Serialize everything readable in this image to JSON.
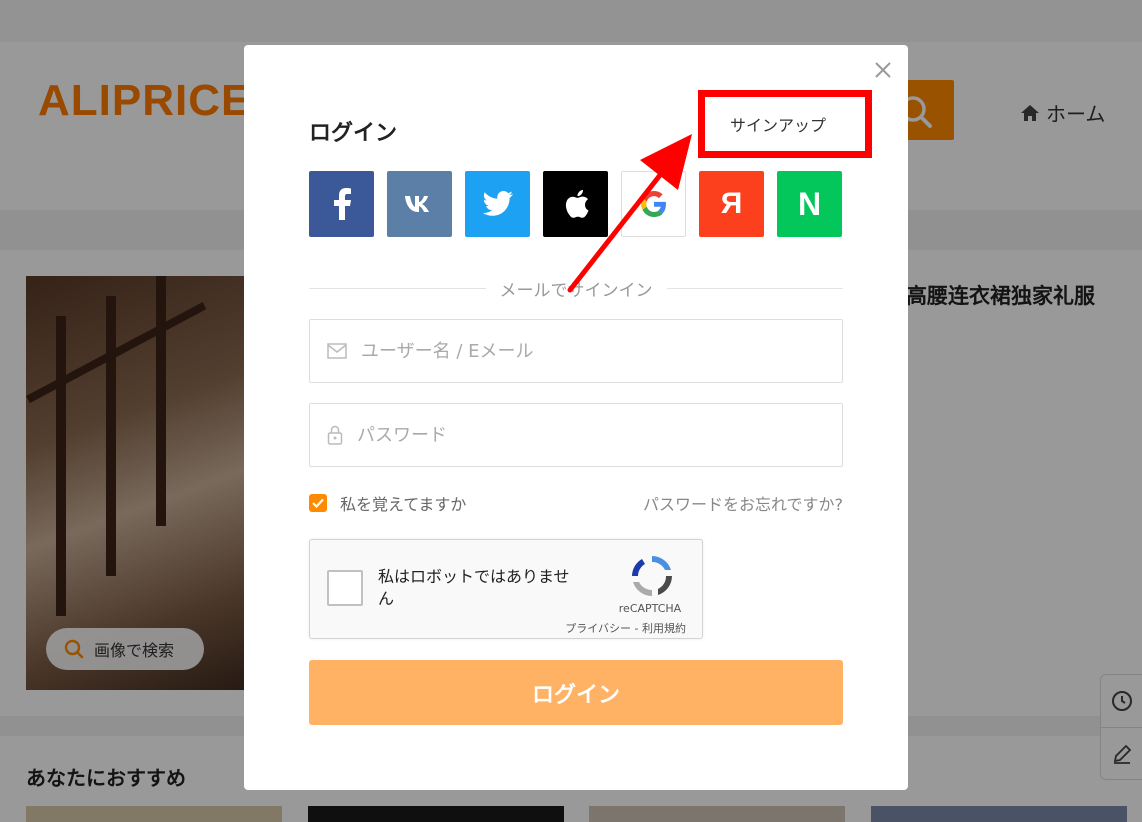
{
  "background": {
    "logo": "ALIPRICE",
    "home_label": "ホーム",
    "product_title": "高腰连衣裙独家礼服",
    "image_search_label": "画像で検索",
    "recommend_title": "あなたにおすすめ"
  },
  "modal": {
    "title": "ログイン",
    "signup_label": "サインアップ",
    "social": [
      {
        "name": "facebook",
        "glyph": "f",
        "color": "#3b5998"
      },
      {
        "name": "vk",
        "glyph": "vk",
        "color": "#5b7fa6"
      },
      {
        "name": "twitter",
        "glyph": "twitter",
        "color": "#1da1f2"
      },
      {
        "name": "apple",
        "glyph": "apple",
        "color": "#000000"
      },
      {
        "name": "google",
        "glyph": "G",
        "color": "#ffffff"
      },
      {
        "name": "yandex",
        "glyph": "Я",
        "color": "#fc3f1d"
      },
      {
        "name": "naver",
        "glyph": "N",
        "color": "#03c75a"
      }
    ],
    "divider_text": "メールでサインイン",
    "username_placeholder": "ユーザー名 / Eメール",
    "password_placeholder": "パスワード",
    "remember_label": "私を覚えてますか",
    "forgot_label": "パスワードをお忘れですか?",
    "recaptcha": {
      "label": "私はロボットではありません",
      "brand": "reCAPTCHA",
      "terms": "プライバシー - 利用規約"
    },
    "login_button": "ログイン"
  },
  "colors": {
    "accent": "#ff8a00",
    "login_button": "#ffb263",
    "annotation": "#ff0000"
  }
}
